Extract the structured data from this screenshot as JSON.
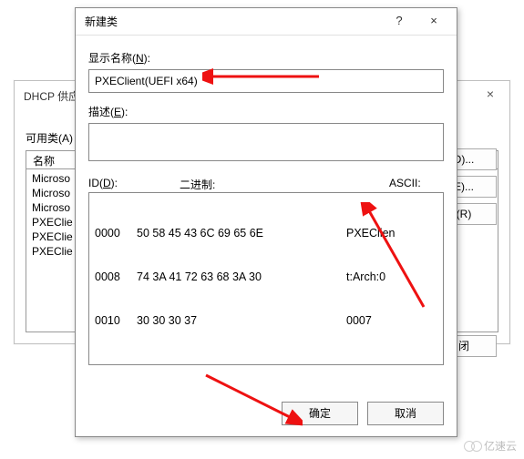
{
  "back_dialog": {
    "title": "DHCP 供应",
    "close": "×",
    "available_label": "可用类(A)",
    "name_header": "名称",
    "items": [
      "Microso",
      "Microso",
      "Microso",
      "PXEClie",
      "PXEClie",
      "PXEClie"
    ],
    "btn_add": "D)...",
    "btn_edit": "E)...",
    "btn_remove": "(R)",
    "bottom_btn": "闭"
  },
  "front_dialog": {
    "title": "新建类",
    "help": "?",
    "close": "×",
    "display_name_label_pre": "显示名称(",
    "display_name_key": "N",
    "display_name_label_post": "):",
    "display_name_value": "PXEClient(UEFI x64)",
    "desc_label_pre": "描述(",
    "desc_key": "E",
    "desc_label_post": "):",
    "desc_value": "",
    "id_label_pre": "ID(",
    "id_key": "D",
    "id_label_post": "):",
    "binary_label": "二进制:",
    "ascii_label": "ASCII:",
    "hex_rows": [
      {
        "offset": "0000",
        "bytes": "50 58 45 43 6C 69 65 6E",
        "ascii": "PXEClien"
      },
      {
        "offset": "0008",
        "bytes": "74 3A 41 72 63 68 3A 30",
        "ascii": "t:Arch:0"
      },
      {
        "offset": "0010",
        "bytes": "30 30 30 37",
        "ascii": "0007"
      }
    ],
    "ok": "确定",
    "cancel": "取消"
  },
  "watermark": "亿速云"
}
